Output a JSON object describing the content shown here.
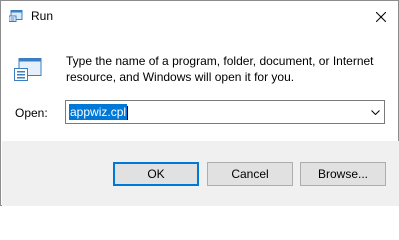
{
  "window": {
    "title": "Run",
    "close_icon": "close-icon",
    "app_icon": "run-icon"
  },
  "dialog": {
    "description": "Type the name of a program, folder, document, or Internet resource, and Windows will open it for you.",
    "icon": "run-icon",
    "open_label": "Open:",
    "open_value": "appwiz.cpl",
    "dropdown_icon": "chevron-down-icon"
  },
  "buttons": {
    "ok_label": "OK",
    "cancel_label": "Cancel",
    "browse_label": "Browse..."
  },
  "colors": {
    "accent": "#0078d7",
    "footer_bg": "#f0f0f0",
    "button_bg": "#e1e1e1"
  }
}
